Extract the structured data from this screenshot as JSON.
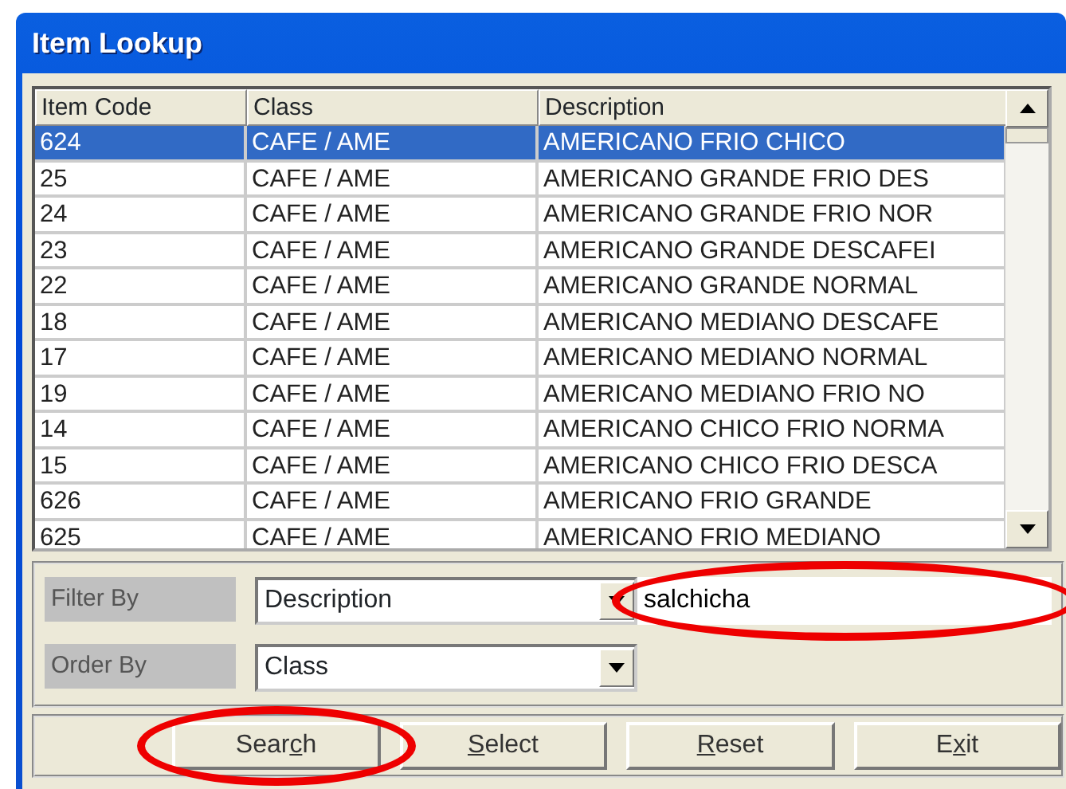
{
  "window": {
    "title": "Item Lookup"
  },
  "table": {
    "columns": [
      "Item Code",
      "Class",
      "Description"
    ],
    "rows": [
      {
        "cells": [
          "624",
          "CAFE / AME",
          "AMERICANO FRIO CHICO"
        ],
        "selected": true
      },
      {
        "cells": [
          "25",
          "CAFE / AME",
          "AMERICANO GRANDE FRIO DES"
        ],
        "selected": false
      },
      {
        "cells": [
          "24",
          "CAFE / AME",
          "AMERICANO GRANDE FRIO NOR"
        ],
        "selected": false
      },
      {
        "cells": [
          "23",
          "CAFE / AME",
          "AMERICANO GRANDE DESCAFEI"
        ],
        "selected": false
      },
      {
        "cells": [
          "22",
          "CAFE / AME",
          "AMERICANO GRANDE NORMAL"
        ],
        "selected": false
      },
      {
        "cells": [
          "18",
          "CAFE / AME",
          "AMERICANO MEDIANO DESCAFE"
        ],
        "selected": false
      },
      {
        "cells": [
          "17",
          "CAFE / AME",
          "AMERICANO MEDIANO NORMAL"
        ],
        "selected": false
      },
      {
        "cells": [
          "19",
          "CAFE / AME",
          "AMERICANO MEDIANO FRIO NO"
        ],
        "selected": false
      },
      {
        "cells": [
          "14",
          "CAFE / AME",
          "AMERICANO CHICO FRIO NORMA"
        ],
        "selected": false
      },
      {
        "cells": [
          "15",
          "CAFE / AME",
          "AMERICANO CHICO FRIO DESCA"
        ],
        "selected": false
      },
      {
        "cells": [
          "626",
          "CAFE / AME",
          "AMERICANO FRIO GRANDE"
        ],
        "selected": false
      },
      {
        "cells": [
          "625",
          "CAFE / AME",
          "AMERICANO FRIO MEDIANO"
        ],
        "selected": false
      }
    ]
  },
  "filter": {
    "filter_label": "Filter By",
    "filter_value": "Description",
    "filter_text": {
      "value": "salchicha",
      "circled": true
    },
    "order_label": "Order By",
    "order_value": "Class"
  },
  "buttons": [
    {
      "before": "Sear",
      "key": "c",
      "after": "h",
      "circled": true
    },
    {
      "key": "S",
      "after": "elect",
      "circled": false
    },
    {
      "key": "R",
      "after": "eset",
      "circled": false
    },
    {
      "before": "E",
      "key": "x",
      "after": "it",
      "circled": false
    }
  ]
}
